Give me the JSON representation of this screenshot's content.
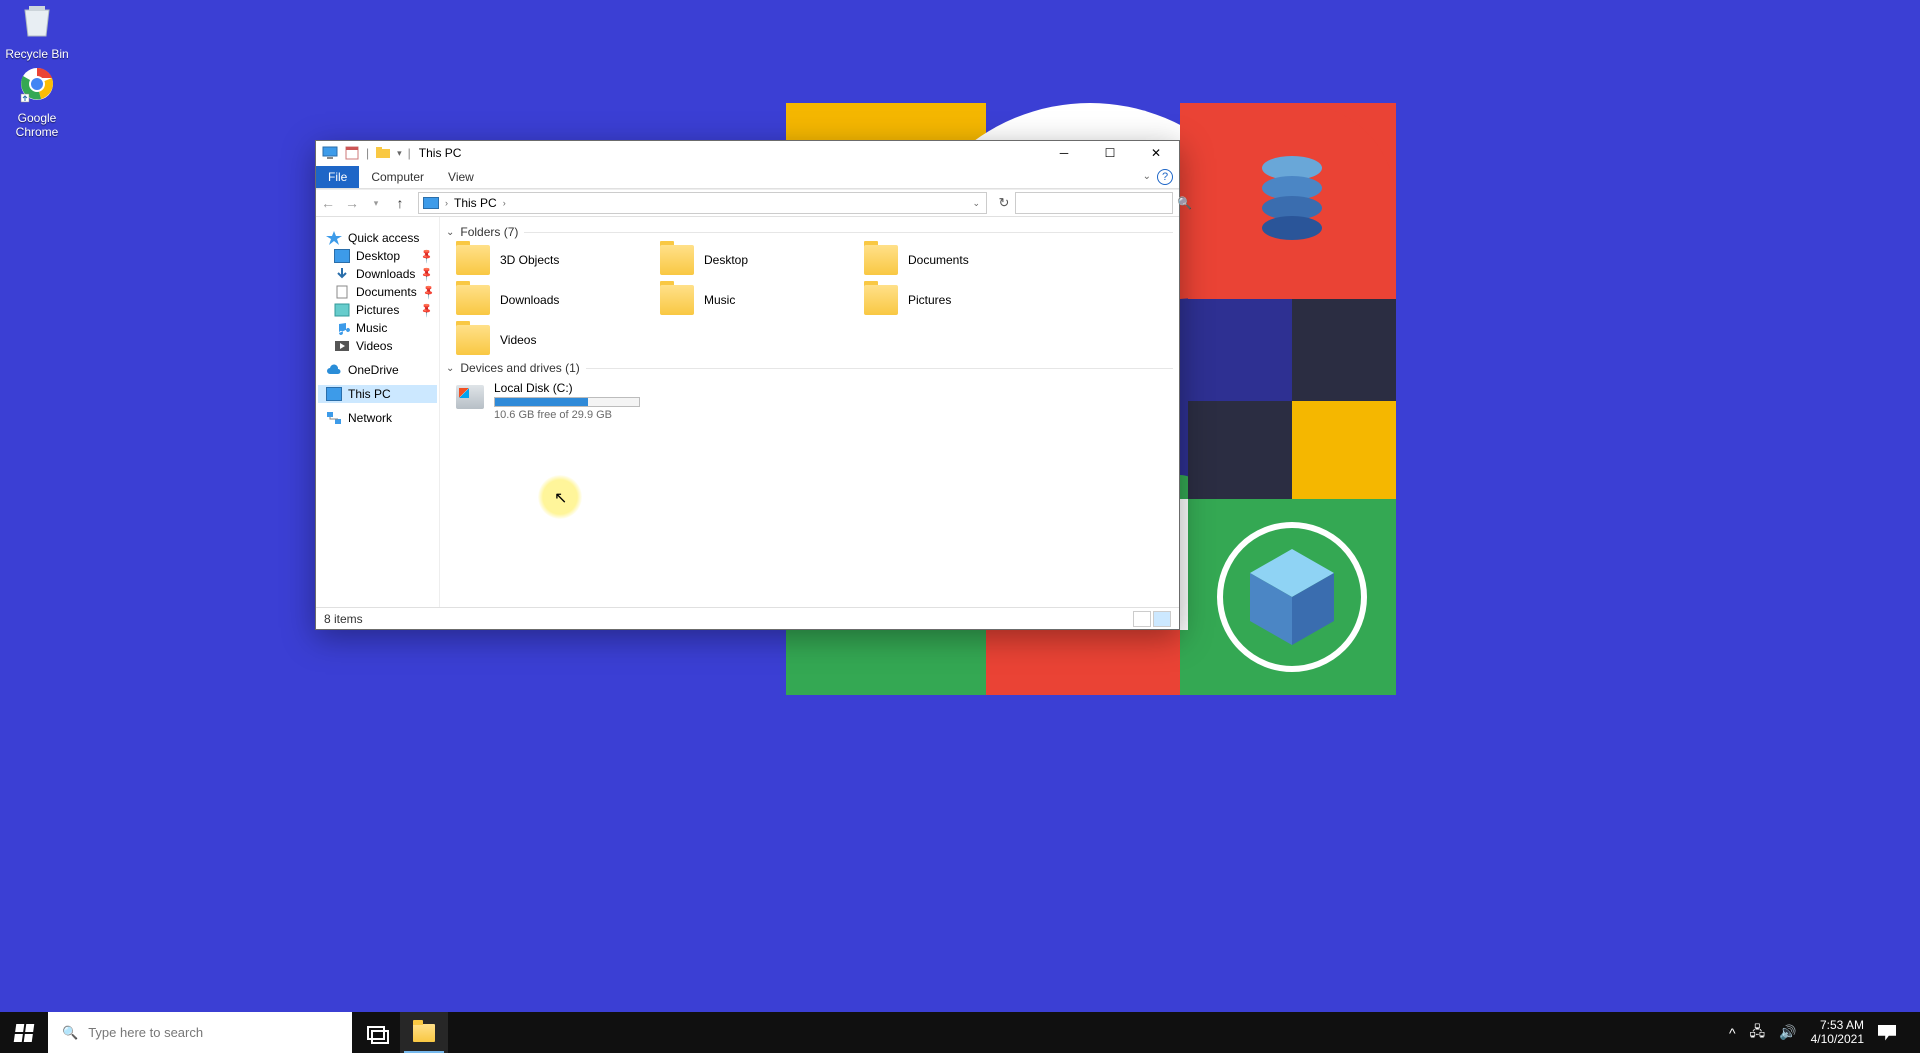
{
  "desktop": {
    "recycle": "Recycle Bin",
    "chrome": "Google Chrome"
  },
  "window": {
    "title": "This PC",
    "tabs": {
      "file": "File",
      "computer": "Computer",
      "view": "View"
    },
    "breadcrumb": "This PC",
    "nav": {
      "quick_access": "Quick access",
      "desktop": "Desktop",
      "downloads": "Downloads",
      "documents": "Documents",
      "pictures": "Pictures",
      "music": "Music",
      "videos": "Videos",
      "onedrive": "OneDrive",
      "this_pc": "This PC",
      "network": "Network"
    },
    "group_folders": "Folders (7)",
    "folders": [
      "3D Objects",
      "Desktop",
      "Documents",
      "Downloads",
      "Music",
      "Pictures",
      "Videos"
    ],
    "group_drives": "Devices and drives (1)",
    "drive": {
      "label": "Local Disk (C:)",
      "free_text": "10.6 GB free of 29.9 GB",
      "used_pct": 64.5
    },
    "status": "8 items"
  },
  "taskbar": {
    "search_placeholder": "Type here to search",
    "time": "7:53 AM",
    "date": "4/10/2021"
  }
}
